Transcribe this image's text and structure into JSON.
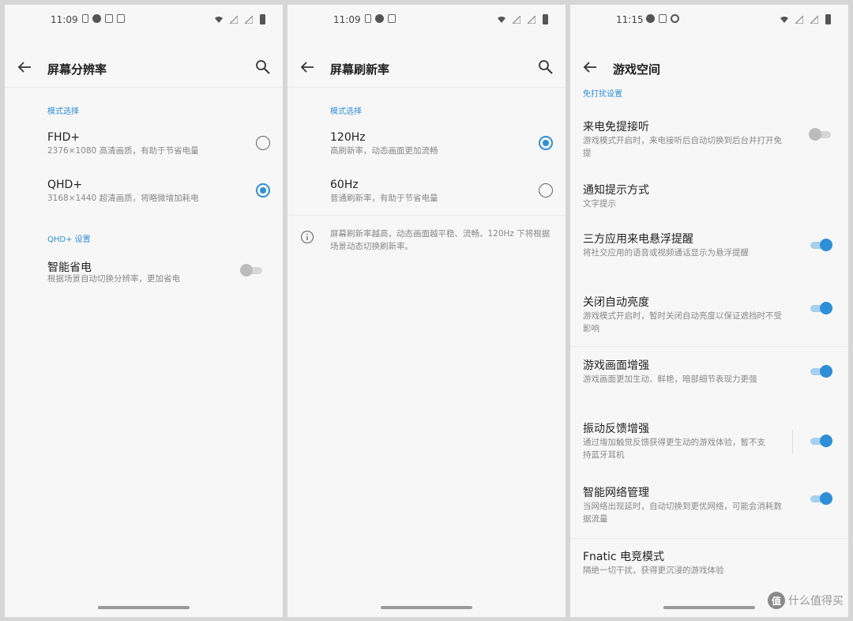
{
  "colors": {
    "accent": "#2e8fd6",
    "background": "#f7f7f7",
    "frame": "#d6d6d6"
  },
  "screen1": {
    "time": "11:09",
    "title": "屏幕分辨率",
    "section_mode": "模式选择",
    "fhd": {
      "title": "FHD+",
      "subtitle": "2376×1080 高清画质，有助于节省电量",
      "selected": false
    },
    "qhd": {
      "title": "QHD+",
      "subtitle": "3168×1440 超清画质，将略微增加耗电",
      "selected": true
    },
    "section_qhd": "QHD+ 设置",
    "smart": {
      "title": "智能省电",
      "subtitle": "根据场景自动切换分辨率，更加省电",
      "on": false
    }
  },
  "screen2": {
    "time": "11:09",
    "title": "屏幕刷新率",
    "section_mode": "模式选择",
    "hz120": {
      "title": "120Hz",
      "subtitle": "高刷新率，动态画面更加流畅",
      "selected": true
    },
    "hz60": {
      "title": "60Hz",
      "subtitle": "普通刷新率，有助于节省电量",
      "selected": false
    },
    "info": "屏幕刷新率越高，动态画面越平稳、流畅。120Hz 下将根据场景动态切换刷新率。"
  },
  "screen3": {
    "time": "11:15",
    "title": "游戏空间",
    "section_dnd": "免打扰设置",
    "items": [
      {
        "title": "来电免提接听",
        "subtitle": "游戏模式开启时，来电接听后自动切换到后台并打开免提",
        "on": false
      },
      {
        "title": "通知提示方式",
        "subtitle": "文字提示"
      },
      {
        "title": "三方应用来电悬浮提醒",
        "subtitle": "将社交应用的语音或视频通话显示为悬浮提醒",
        "on": true
      },
      {
        "title": "关闭自动亮度",
        "subtitle": "游戏模式开启时，暂时关闭自动亮度以保证遮挡时不受影响",
        "on": true
      },
      {
        "title": "游戏画面增强",
        "subtitle": "游戏画面更加生动、鲜艳，暗部细节表现力更强",
        "on": true
      },
      {
        "title": "振动反馈增强",
        "subtitle": "通过增加触觉反馈获得更生动的游戏体验，暂不支持蓝牙耳机",
        "on": true
      },
      {
        "title": "智能网络管理",
        "subtitle": "当网络出现延时，自动切换到更优网络，可能会消耗数据流量",
        "on": true
      },
      {
        "title": "Fnatic 电竞模式",
        "subtitle": "隔绝一切干扰，获得更沉浸的游戏体验"
      }
    ]
  },
  "watermark": {
    "logo": "值",
    "text": "什么值得买"
  }
}
